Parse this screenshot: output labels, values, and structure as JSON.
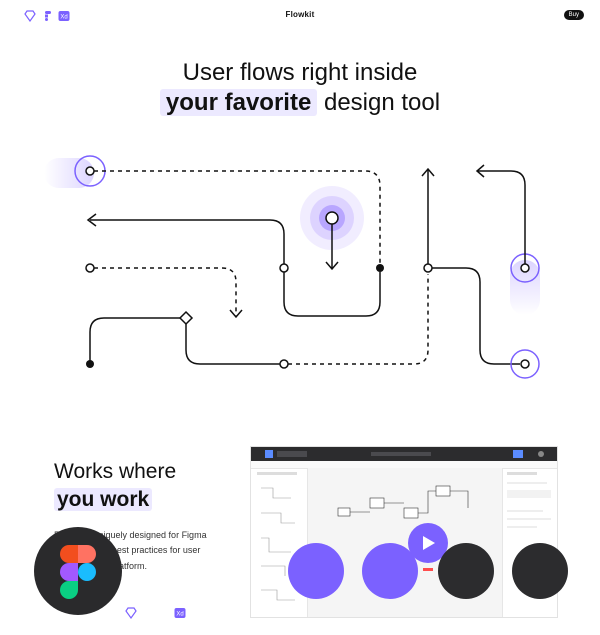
{
  "header": {
    "brand": "Flowkit",
    "buy_label": "Buy"
  },
  "hero": {
    "line1": "User flows right inside",
    "highlight": "your favorite",
    "line2_rest": " design tool"
  },
  "works": {
    "line1": "Works where",
    "highlight": "you work"
  },
  "description": {
    "part1": "Flowkit is uniquely designed for Figma and",
    "xd_tag": "XD",
    "part2": "using best practices for user flows for each platform."
  },
  "colors": {
    "accent": "#7b61ff",
    "accent_light": "#ece9ff",
    "dark": "#2c2c2e"
  }
}
